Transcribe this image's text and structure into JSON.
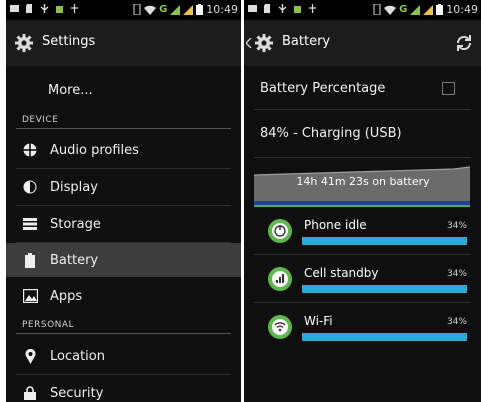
{
  "statusbar": {
    "time_left": "10:49",
    "time_right": "10:49",
    "net_left": "G",
    "net_right": "G"
  },
  "left": {
    "title": "Settings",
    "more": "More...",
    "section_device": "DEVICE",
    "section_personal": "PERSONAL",
    "items": [
      {
        "label": "Audio profiles"
      },
      {
        "label": "Display"
      },
      {
        "label": "Storage"
      },
      {
        "label": "Battery"
      },
      {
        "label": "Apps"
      },
      {
        "label": "Location"
      },
      {
        "label": "Security"
      }
    ]
  },
  "right": {
    "title": "Battery",
    "battery_percentage_label": "Battery Percentage",
    "battery_percentage_checked": false,
    "status": "84% - Charging (USB)",
    "graph_label": "14h 41m 23s on battery",
    "usage": [
      {
        "name": "Phone idle",
        "pct": "34%",
        "fraction": 1.0
      },
      {
        "name": "Cell standby",
        "pct": "34%",
        "fraction": 1.0
      },
      {
        "name": "Wi-Fi",
        "pct": "34%",
        "fraction": 1.0
      }
    ]
  },
  "colors": {
    "accent": "#33a6d6",
    "icon_green": "#5cb84a",
    "selected_row": "#3d3d3d",
    "graph_fill": "#6b6b6b"
  }
}
